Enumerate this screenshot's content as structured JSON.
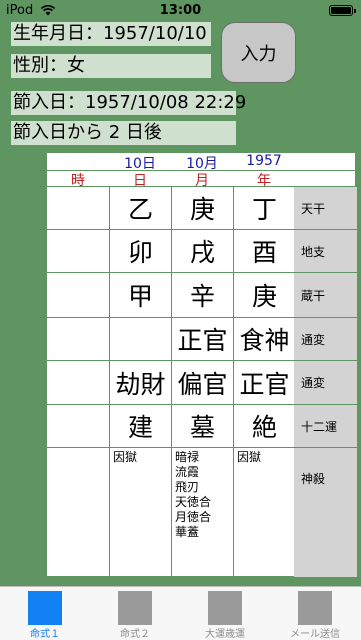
{
  "status_bar": {
    "carrier": "iPod",
    "time": "13:00"
  },
  "form": {
    "birth_date": "生年月日：1957/10/10",
    "gender": "性別：女",
    "setsu_date": "節入日：1957/10/08 22:29",
    "days_after": "節入日から 2 日後",
    "enter_button": "入力"
  },
  "table": {
    "top_headers": [
      "10日",
      "10月",
      "1957"
    ],
    "pillar_headers": [
      "時",
      "日",
      "月",
      "年"
    ],
    "rows": [
      {
        "label": "天干",
        "cells": [
          "",
          "乙",
          "庚",
          "丁"
        ]
      },
      {
        "label": "地支",
        "cells": [
          "",
          "卯",
          "戌",
          "酉"
        ]
      },
      {
        "label": "蔵干",
        "cells": [
          "",
          "甲",
          "辛",
          "庚"
        ]
      },
      {
        "label": "通変",
        "cells": [
          "",
          "",
          "正官",
          "食神"
        ]
      },
      {
        "label": "通変",
        "cells": [
          "",
          "劫財",
          "偏官",
          "正官"
        ]
      },
      {
        "label": "十二運",
        "cells": [
          "",
          "建",
          "墓",
          "絶"
        ]
      }
    ],
    "shinsatsu": {
      "label": "神殺",
      "day": [
        "因獄"
      ],
      "month": [
        "暗禄",
        "流霞",
        "飛刃",
        "天徳合",
        "月徳合",
        "華蓋"
      ],
      "year": [
        "因獄"
      ]
    }
  },
  "tabs": [
    {
      "label": "命式１",
      "active": true
    },
    {
      "label": "命式２",
      "active": false
    },
    {
      "label": "大運歳運",
      "active": false
    },
    {
      "label": "メール送信",
      "active": false
    }
  ],
  "colors": {
    "background": "#5e9561",
    "active_tab": "#1181f3",
    "pillar_header_red": "#c02020",
    "top_header_blue": "#1a1aa0"
  }
}
